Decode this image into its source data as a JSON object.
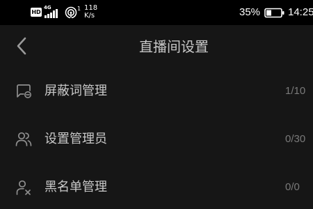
{
  "status_bar": {
    "hd_badge": "HD",
    "network_type": "4G",
    "hotspot_count": "1",
    "speed_value": "118",
    "speed_unit": "K/s",
    "battery_percent": "35%",
    "time": "14:25",
    "battery_level": 0.35
  },
  "header": {
    "title": "直播间设置",
    "back_icon": "chevron-left-icon"
  },
  "rows": [
    {
      "label": "屏蔽词管理",
      "count": "1/10",
      "icon": "message-block-icon"
    },
    {
      "label": "设置管理员",
      "count": "0/30",
      "icon": "users-icon"
    },
    {
      "label": "黑名单管理",
      "count": "0/0",
      "icon": "user-blocked-icon"
    }
  ],
  "colors": {
    "background": "#161616",
    "status_bar": "#000000",
    "title": "#c7c7c7",
    "label": "#c9c9c9",
    "count": "#7a7a7a",
    "icon": "#8e8e8e"
  }
}
